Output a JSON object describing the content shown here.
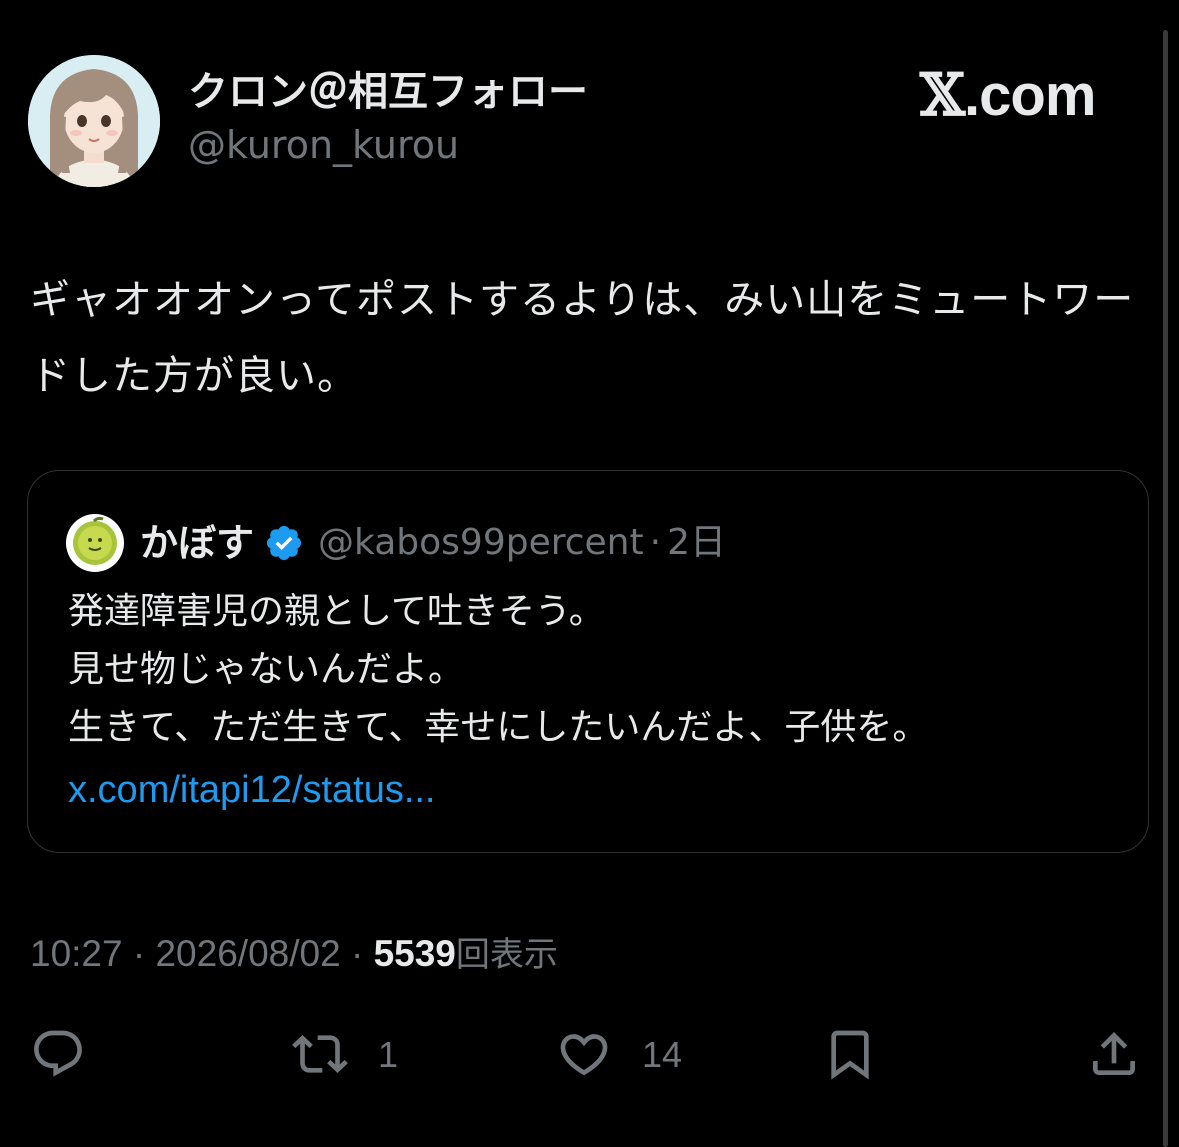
{
  "post": {
    "author": {
      "display_name": "クロン＠相互フォロー",
      "handle": "@kuron_kurou",
      "avatar": "illustrated-girl-avatar"
    },
    "brand": {
      "x_glyph": "𝕏",
      "domain": ".com"
    },
    "text": "ギャオオオンってポストするよりは、みい山をミュートワードした方が良い。",
    "quote": {
      "author_name": "かぼす",
      "verified": true,
      "verified_color": "#1d9bf0",
      "handle": "@kabos99percent",
      "separator": "·",
      "time": "2日",
      "avatar": "green-kabosu-fruit-avatar",
      "lines": [
        "発達障害児の親として吐きそう。",
        "見せ物じゃないんだよ。",
        "生きて、ただ生きて、幸せにしたいんだよ、子供を。"
      ],
      "link": "x.com/itapi12/status..."
    },
    "meta": {
      "time": "10:27",
      "separator": "·",
      "date": "2026/08/02",
      "views_count": "5539",
      "views_label": "回表示"
    },
    "actions": {
      "reply_icon": "reply-icon",
      "repost_icon": "repost-icon",
      "repost_count": "1",
      "like_icon": "heart-icon",
      "like_count": "14",
      "bookmark_icon": "bookmark-icon",
      "share_icon": "share-icon"
    }
  },
  "colors": {
    "background": "#000000",
    "text_primary": "#e7e9ea",
    "text_secondary": "#71767b",
    "link": "#1d9bf0",
    "border": "#2f3336"
  }
}
